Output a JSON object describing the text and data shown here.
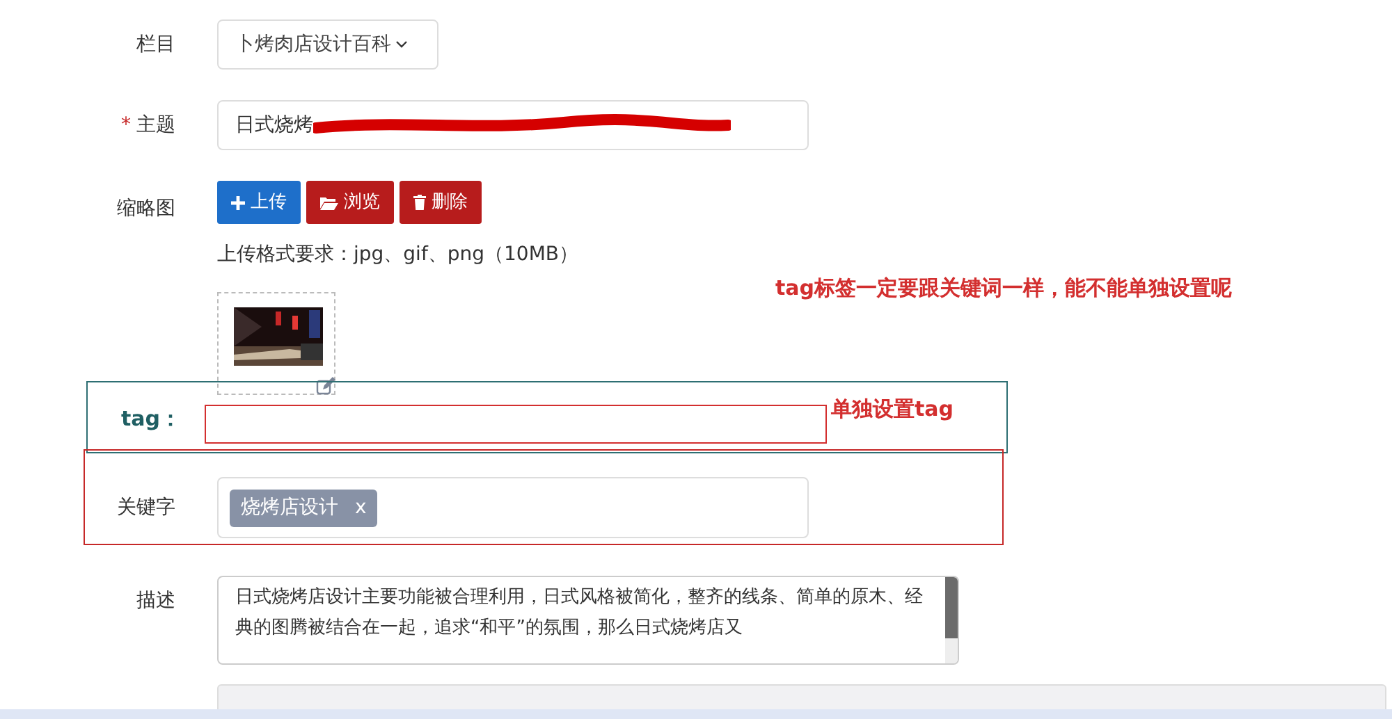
{
  "category": {
    "label": "栏目",
    "value": "卜烤肉店设计百科"
  },
  "subject": {
    "label": "主题",
    "required_mark": "*",
    "value": "日式烧烤",
    "redacted": true
  },
  "thumbnail": {
    "label": "缩略图",
    "buttons": [
      {
        "label": "上传",
        "kind": "upload"
      },
      {
        "label": "浏览",
        "kind": "browse"
      },
      {
        "label": "删除",
        "kind": "delete"
      }
    ],
    "hint": "上传格式要求：jpg、gif、png（10MB）"
  },
  "tag": {
    "label": "tag："
  },
  "keywords": {
    "label": "关键字",
    "chips": [
      {
        "text": "烧烤店设计",
        "remove": "x"
      }
    ]
  },
  "description": {
    "label": "描述",
    "value": "日式烧烤店设计主要功能被合理利用，日式风格被简化，整齐的线条、简单的原木、经典的图腾被结合在一起，追求“和平”的氛围，那么日式烧烤店又"
  },
  "annotations": [
    {
      "text": "tag标签一定要跟关键词一样，能不能单独设置呢"
    },
    {
      "text": "单独设置tag"
    }
  ]
}
